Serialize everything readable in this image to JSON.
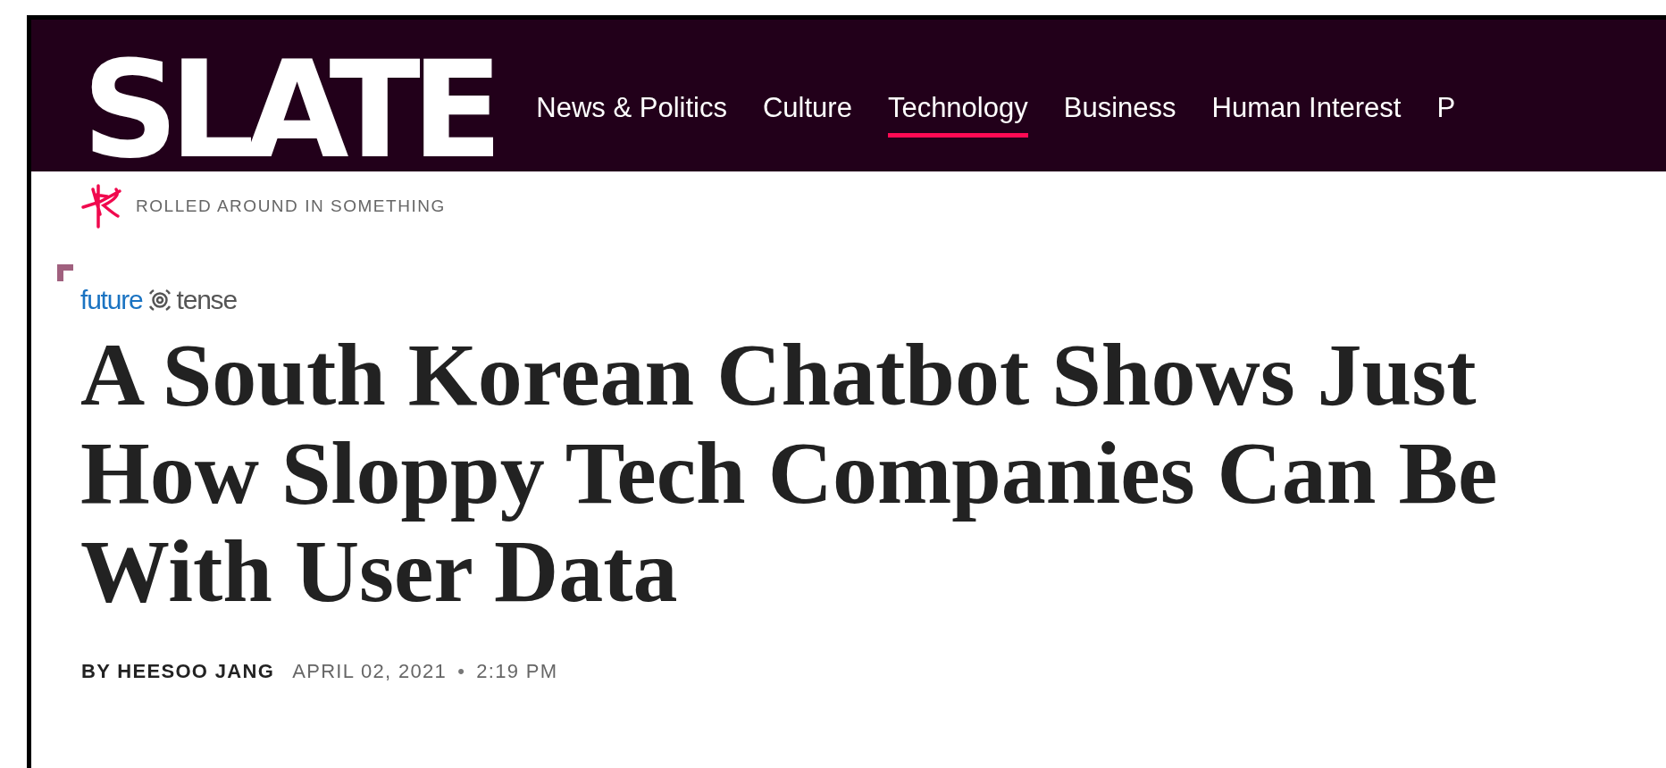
{
  "site": {
    "logo": "SLATE"
  },
  "nav": [
    {
      "label": "News & Politics",
      "selected": false
    },
    {
      "label": "Culture",
      "selected": false
    },
    {
      "label": "Technology",
      "selected": true
    },
    {
      "label": "Business",
      "selected": false
    },
    {
      "label": "Human Interest",
      "selected": false
    },
    {
      "label": "P",
      "selected": false
    }
  ],
  "column": {
    "label": "ROLLED AROUND IN SOMETHING"
  },
  "section": {
    "brand_first": "future",
    "brand_second": "tense"
  },
  "article": {
    "headline": "A South Korean Chatbot Shows Just How Sloppy Tech Companies Can Be With User Data",
    "author": "BY HEESOO JANG",
    "date": "APRIL 02, 2021",
    "separator": "•",
    "time": "2:19 PM"
  }
}
